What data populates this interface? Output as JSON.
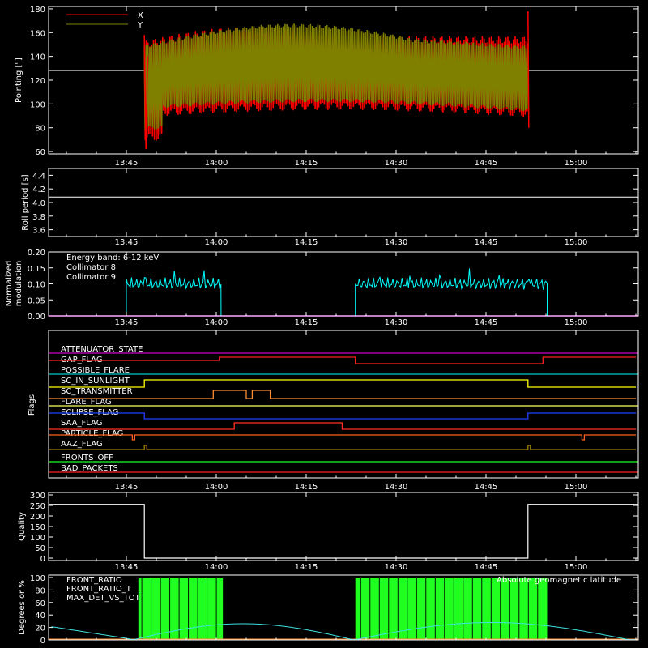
{
  "panels": {
    "pointing": {
      "ylabel": "Pointing [\"]",
      "yticks": [
        "60",
        "80",
        "100",
        "120",
        "140",
        "160",
        "180"
      ],
      "xticks": [
        "13:45",
        "14:00",
        "14:15",
        "14:30",
        "14:45",
        "15:00"
      ],
      "legend": [
        {
          "name": "X",
          "color": "#ff0000"
        },
        {
          "name": "Y",
          "color": "#7f7f00"
        }
      ],
      "center_line": 128
    },
    "roll": {
      "ylabel": "Roll period [s]",
      "yticks": [
        "3.6",
        "3.8",
        "4.0",
        "4.2",
        "4.4"
      ],
      "xticks": [
        "13:45",
        "14:00",
        "14:15",
        "14:30",
        "14:45",
        "15:00"
      ],
      "value": 4.08
    },
    "modulation": {
      "ylabel_line1": "Normalized",
      "ylabel_line2": "modulation",
      "yticks": [
        "0.00",
        "0.05",
        "0.10",
        "0.15",
        "0.20"
      ],
      "xticks": [
        "13:45",
        "14:00",
        "14:15",
        "14:30",
        "14:45",
        "15:00"
      ],
      "energy_band": "Energy band: 6-12 keV",
      "legend": [
        {
          "name": "Collimator 8",
          "color": "#00ffff"
        },
        {
          "name": "Collimator 9",
          "color": "#ff00ff"
        }
      ]
    },
    "flags": {
      "ylabel": "Flags",
      "xticks": [
        "13:45",
        "14:00",
        "14:15",
        "14:30",
        "14:45",
        "15:00"
      ],
      "items": [
        {
          "name": "ATTENUATOR_STATE",
          "color": "#cc00cc"
        },
        {
          "name": "GAP_FLAG",
          "color": "#ff2020"
        },
        {
          "name": "POSSIBLE_FLARE",
          "color": "#00c8c8"
        },
        {
          "name": "SC_IN_SUNLIGHT",
          "color": "#ffff00"
        },
        {
          "name": "SC_TRANSMITTER",
          "color": "#ff8c30"
        },
        {
          "name": "FLARE_FLAG",
          "color": "#ffff60"
        },
        {
          "name": "ECLIPSE_FLAG",
          "color": "#2040ff"
        },
        {
          "name": "SAA_FLAG",
          "color": "#ff3020"
        },
        {
          "name": "PARTICLE_FLAG",
          "color": "#ff6020"
        },
        {
          "name": "AAZ_FLAG",
          "color": "#a08000"
        },
        {
          "name": "FRONTS_OFF",
          "color": "#20ff20"
        },
        {
          "name": "BAD_PACKETS",
          "color": "#ff2020"
        }
      ]
    },
    "quality": {
      "ylabel": "Quality",
      "yticks": [
        "0",
        "50",
        "100",
        "150",
        "200",
        "250",
        "300"
      ],
      "xticks": [
        "13:45",
        "14:00",
        "14:15",
        "14:30",
        "14:45",
        "15:00"
      ]
    },
    "ratios": {
      "ylabel": "Degrees or %",
      "yticks": [
        "0",
        "20",
        "40",
        "60",
        "80",
        "100"
      ],
      "legend": [
        {
          "name": "FRONT_RATIO",
          "color": "#ffff00"
        },
        {
          "name": "FRONT_RATIO_T",
          "color": "#20ff20"
        },
        {
          "name": "MAX_DET_VS_TOT",
          "color": "#ff8c30"
        }
      ],
      "right_label": "Absolute geomagnetic latitude"
    }
  },
  "chart_data": [
    {
      "type": "line",
      "title": "",
      "ylabel": "Pointing [\"]",
      "ylim": [
        58,
        182
      ],
      "x": [
        "13:48",
        "14:00",
        "14:15",
        "14:30",
        "14:45",
        "14:52"
      ],
      "series": [
        {
          "name": "X",
          "values": [
            140,
            140,
            140,
            140,
            140,
            140
          ]
        },
        {
          "name": "Y",
          "values": [
            130,
            130,
            130,
            130,
            130,
            130
          ]
        }
      ]
    },
    {
      "type": "line",
      "ylabel": "Roll period [s]",
      "ylim": [
        3.5,
        4.5
      ],
      "x": [
        "13:32",
        "15:10"
      ],
      "series": [
        {
          "values": [
            4.08,
            4.08
          ]
        }
      ]
    },
    {
      "type": "line",
      "ylabel": "Normalized modulation",
      "ylim": [
        0,
        0.2
      ],
      "x": [
        "13:45",
        "14:01",
        "14:23",
        "14:55"
      ],
      "series": [
        {
          "name": "Collimator 8",
          "values": [
            0.1,
            0.1,
            0.1,
            0.1
          ]
        },
        {
          "name": "Collimator 9",
          "values": [
            0,
            0,
            0,
            0
          ]
        }
      ]
    },
    {
      "type": "line",
      "ylabel": "Quality",
      "ylim": [
        0,
        300
      ],
      "x": [
        "13:32",
        "13:48",
        "13:48",
        "14:52",
        "14:52",
        "15:10"
      ],
      "series": [
        {
          "values": [
            255,
            255,
            0,
            0,
            255,
            255
          ]
        }
      ]
    },
    {
      "type": "bar",
      "ylabel": "Degrees or %",
      "ylim": [
        0,
        100
      ],
      "x": [
        "13:47",
        "14:01",
        "14:23",
        "14:55"
      ],
      "series": [
        {
          "name": "FRONT_RATIO_T",
          "values": [
            100,
            100,
            100,
            100
          ]
        }
      ]
    }
  ]
}
